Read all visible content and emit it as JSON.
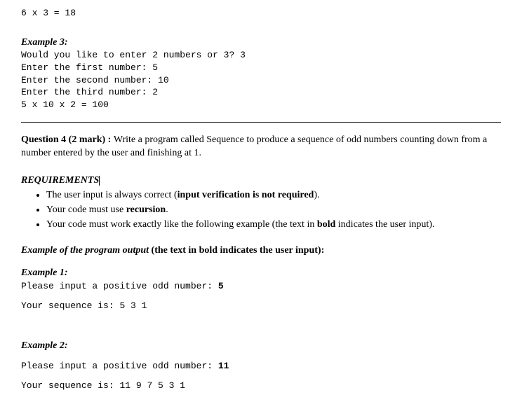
{
  "top_mono": "6 x 3 = 18",
  "example3": {
    "label": "Example 3:",
    "line1_text": "Would you like to enter 2 numbers or 3? ",
    "line1_input": "3",
    "line2_text": "Enter the first number: ",
    "line2_input": "5",
    "line3_text": "Enter the second number: ",
    "line3_input": "10",
    "line4_text": "Enter the third number: ",
    "line4_input": "2",
    "result": "5 x 10 x 2 = 100"
  },
  "q4": {
    "label": "Question 4 (2 mark) : ",
    "text": "Write a program called Sequence to produce a sequence of odd numbers counting down from a number entered by the user and finishing at 1."
  },
  "req": {
    "heading": "REQUIREMENTS",
    "item1_a": "The user input is always correct (",
    "item1_b": "input verification is not required",
    "item1_c": ").",
    "item2_a": "Your code must use ",
    "item2_b": "recursion",
    "item2_c": ".",
    "item3_a": "Your code must work exactly like the following example (the text in ",
    "item3_b": "bold",
    "item3_c": " indicates the user input)."
  },
  "outhead_a": "Example of the program output ",
  "outhead_b": "(the text in bold indicates the user input)",
  "outhead_c": ":",
  "ex1": {
    "label": "Example 1:",
    "prompt": "Please input a positive odd number: ",
    "input": "5",
    "result_label": "Your sequence is: ",
    "result_values": "5 3 1"
  },
  "ex2": {
    "label": "Example 2:",
    "prompt": "Please input a positive odd number: ",
    "input": "11",
    "result_label": "Your sequence is: ",
    "result_values": "11 9 7 5 3 1"
  }
}
